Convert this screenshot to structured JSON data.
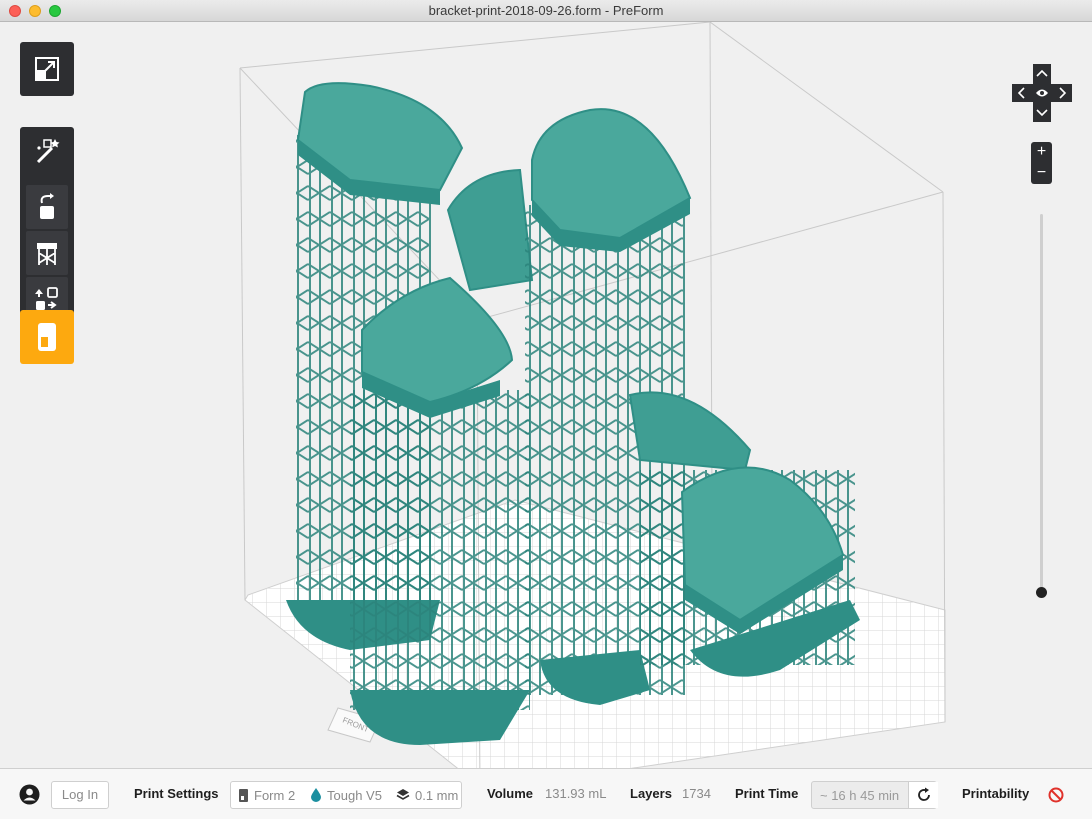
{
  "window": {
    "title": "bracket-print-2018-09-26.form - PreForm"
  },
  "tools": [
    {
      "name": "scale-tool",
      "icon": "scale-icon"
    },
    {
      "name": "one-click-print-tool",
      "icon": "magic-wand-icon"
    },
    {
      "name": "orient-tool",
      "icon": "rotate-icon"
    },
    {
      "name": "supports-tool",
      "icon": "supports-icon"
    },
    {
      "name": "layout-tool",
      "icon": "layout-icon"
    },
    {
      "name": "job-info-tool",
      "icon": "printer-icon"
    }
  ],
  "view_controls": {
    "zoom_in": "+",
    "zoom_out": "−"
  },
  "build_plate": {
    "front_label": "FRONT"
  },
  "bottom_bar": {
    "login_label": "Log In",
    "print_settings_label": "Print Settings",
    "printer": "Form 2",
    "material": "Tough V5",
    "layer_height": "0.1 mm",
    "volume_label": "Volume",
    "volume_value": "131.93 mL",
    "layers_label": "Layers",
    "layers_value": "1734",
    "print_time_label": "Print Time",
    "print_time_value": "~ 16 h 45 min",
    "printability_label": "Printability"
  },
  "colors": {
    "model": "#2f8f86",
    "model_top": "#4aa89c",
    "active_tool": "#fda90f",
    "toolbar": "#2d2e31",
    "printability_status": "#e0322b"
  }
}
